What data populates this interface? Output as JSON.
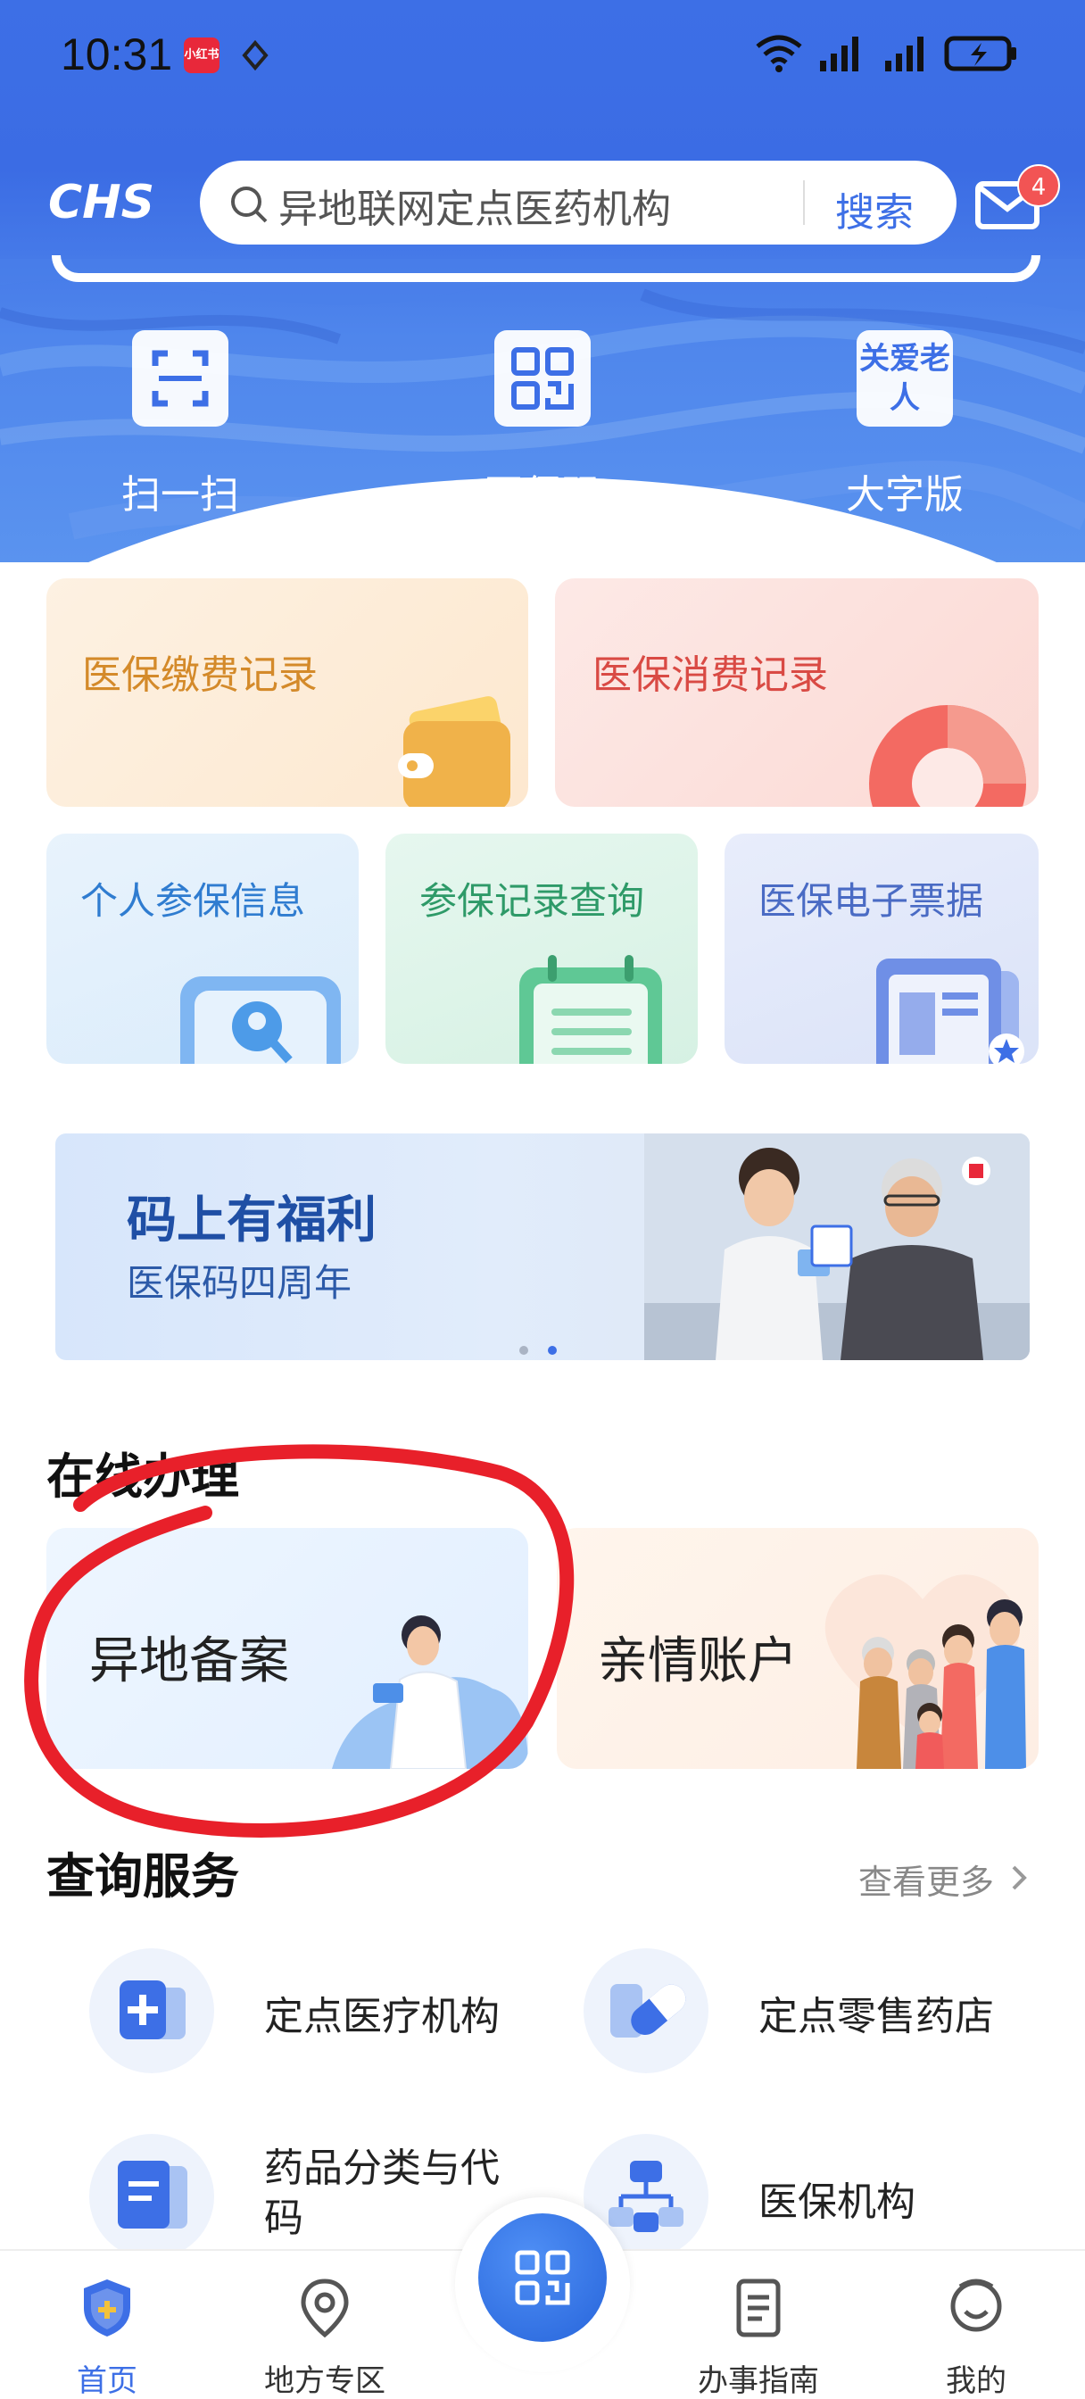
{
  "status_bar": {
    "time": "10:31",
    "app_badge": "小红书",
    "battery_percent": 100
  },
  "header": {
    "logo_text": "CHS",
    "search_placeholder": "异地联网定点医药机构",
    "search_button": "搜索",
    "mail_badge": "4"
  },
  "quick_actions": [
    {
      "label": "扫一扫",
      "icon": "scan-icon"
    },
    {
      "label": "医保码",
      "icon": "qr-code-icon"
    },
    {
      "label": "大字版",
      "icon": "elder-care-icon",
      "icon_text": "关爱老人"
    }
  ],
  "cards": {
    "payment_record": "医保缴费记录",
    "consumption_record": "医保消费记录",
    "personal_info": "个人参保信息",
    "insurance_record": "参保记录查询",
    "e_bill": "医保电子票据"
  },
  "banner": {
    "title": "码上有福利",
    "subtitle": "医保码四周年",
    "slide_index": 2,
    "slide_count": 2
  },
  "online_section": {
    "title": "在线办理",
    "items": [
      {
        "label": "异地备案"
      },
      {
        "label": "亲情账户"
      }
    ]
  },
  "query_section": {
    "title": "查询服务",
    "more": "查看更多",
    "items": [
      {
        "label": "定点医疗机构",
        "icon": "hospital-icon"
      },
      {
        "label": "定点零售药店",
        "icon": "pill-icon"
      },
      {
        "label": "药品分类与代码",
        "icon": "document-icon"
      },
      {
        "label": "医保机构",
        "icon": "organization-icon"
      }
    ]
  },
  "tab_bar": {
    "tabs": [
      {
        "label": "首页",
        "icon": "home-shield-icon",
        "active": true
      },
      {
        "label": "地方专区",
        "icon": "location-icon"
      },
      {
        "label": "",
        "icon": "qr-code-icon"
      },
      {
        "label": "办事指南",
        "icon": "guide-icon"
      },
      {
        "label": "我的",
        "icon": "profile-icon"
      }
    ]
  },
  "colors": {
    "brand": "#3d6fe6",
    "annotation": "#e8202a"
  }
}
